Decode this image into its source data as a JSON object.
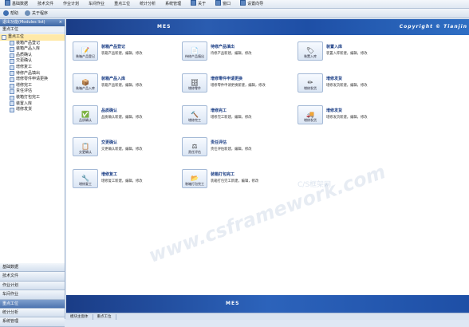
{
  "menubar": {
    "items": [
      "基础数据",
      "技术文件",
      "作业计划",
      "车间作业",
      "重点工位",
      "统计分析",
      "系统管理",
      "关于",
      "窗口",
      "设置向导"
    ]
  },
  "toolbar": {
    "help_label": "帮助",
    "about_label": "关于程序"
  },
  "sidebar": {
    "title": "退出功能(Modules list)",
    "close_symbol": "×",
    "subtitle": "重点工位",
    "root_label": "重点工位",
    "tree_items": [
      "装箱产品登记",
      "装箱产品入库",
      "品质确认",
      "交更确认",
      "增修复工",
      "待修产品填出",
      "增修零件申请更换",
      "增修完工",
      "责任评估",
      "装箱打包完工",
      "装置入库",
      "增修发货"
    ],
    "categories": [
      "基础数据",
      "技术文件",
      "作业计划",
      "车间作业",
      "重点工位",
      "统计分析",
      "系统管理"
    ],
    "active_category": "重点工位"
  },
  "banner": {
    "logo": "MES",
    "copyright": "Copyright © Tianjin"
  },
  "cards": [
    {
      "icon_label": "装箱产品登记",
      "title": "装箱产品登记",
      "desc": "装箱产品新建，编辑，修改",
      "glyph": "📝"
    },
    {
      "icon_label": "装箱产品入库",
      "title": "装箱产品入库",
      "desc": "装箱产品新建，编辑，修改",
      "glyph": "📦"
    },
    {
      "icon_label": "品质确认",
      "title": "品质确认",
      "desc": "品质确认新建，编辑，修改",
      "glyph": "✅"
    },
    {
      "icon_label": "交更确认",
      "title": "交更确认",
      "desc": "交更确认新建，编辑，修改",
      "glyph": "📋"
    },
    {
      "icon_label": "增修复工",
      "title": "增修复工",
      "desc": "增修复工新建，编辑，修改",
      "glyph": "🔧"
    },
    {
      "icon_label": "待修产品填出",
      "title": "待修产品填出",
      "desc": "待修产品新建，编辑，修改",
      "glyph": "📄"
    },
    {
      "icon_label": "增修零件",
      "title": "增修零件申请更换",
      "desc": "增修零件申请更换新建，编辑，修改",
      "glyph": "🗄"
    },
    {
      "icon_label": "增修完工",
      "title": "增修完工",
      "desc": "增修完工新建，编辑，修改",
      "glyph": "🔨"
    },
    {
      "icon_label": "责任评估",
      "title": "责任评估",
      "desc": "责任评估新建，编辑，修改",
      "glyph": "⚖"
    },
    {
      "icon_label": "装箱打包完工",
      "title": "装箱打包完工",
      "desc": "装箱打包完工新建，编辑，修改",
      "glyph": "📂"
    },
    {
      "icon_label": "装置入库",
      "title": "装置入库",
      "desc": "装置入库新建，编辑，修改",
      "glyph": "🏷"
    },
    {
      "icon_label": "增修发货",
      "title": "增修发货",
      "desc": "增修发货新建，编辑，修改",
      "glyph": "✏"
    },
    {
      "icon_label": "增修发货",
      "title": "增修发货",
      "desc": "增修发货新建，编辑，修改",
      "glyph": "🚚"
    }
  ],
  "watermark": "www.csframework.com",
  "watermark2": "C/S框架网",
  "footer": {
    "logo": "MES"
  },
  "status": {
    "left": "模块主窗体",
    "right": "重点工位"
  }
}
